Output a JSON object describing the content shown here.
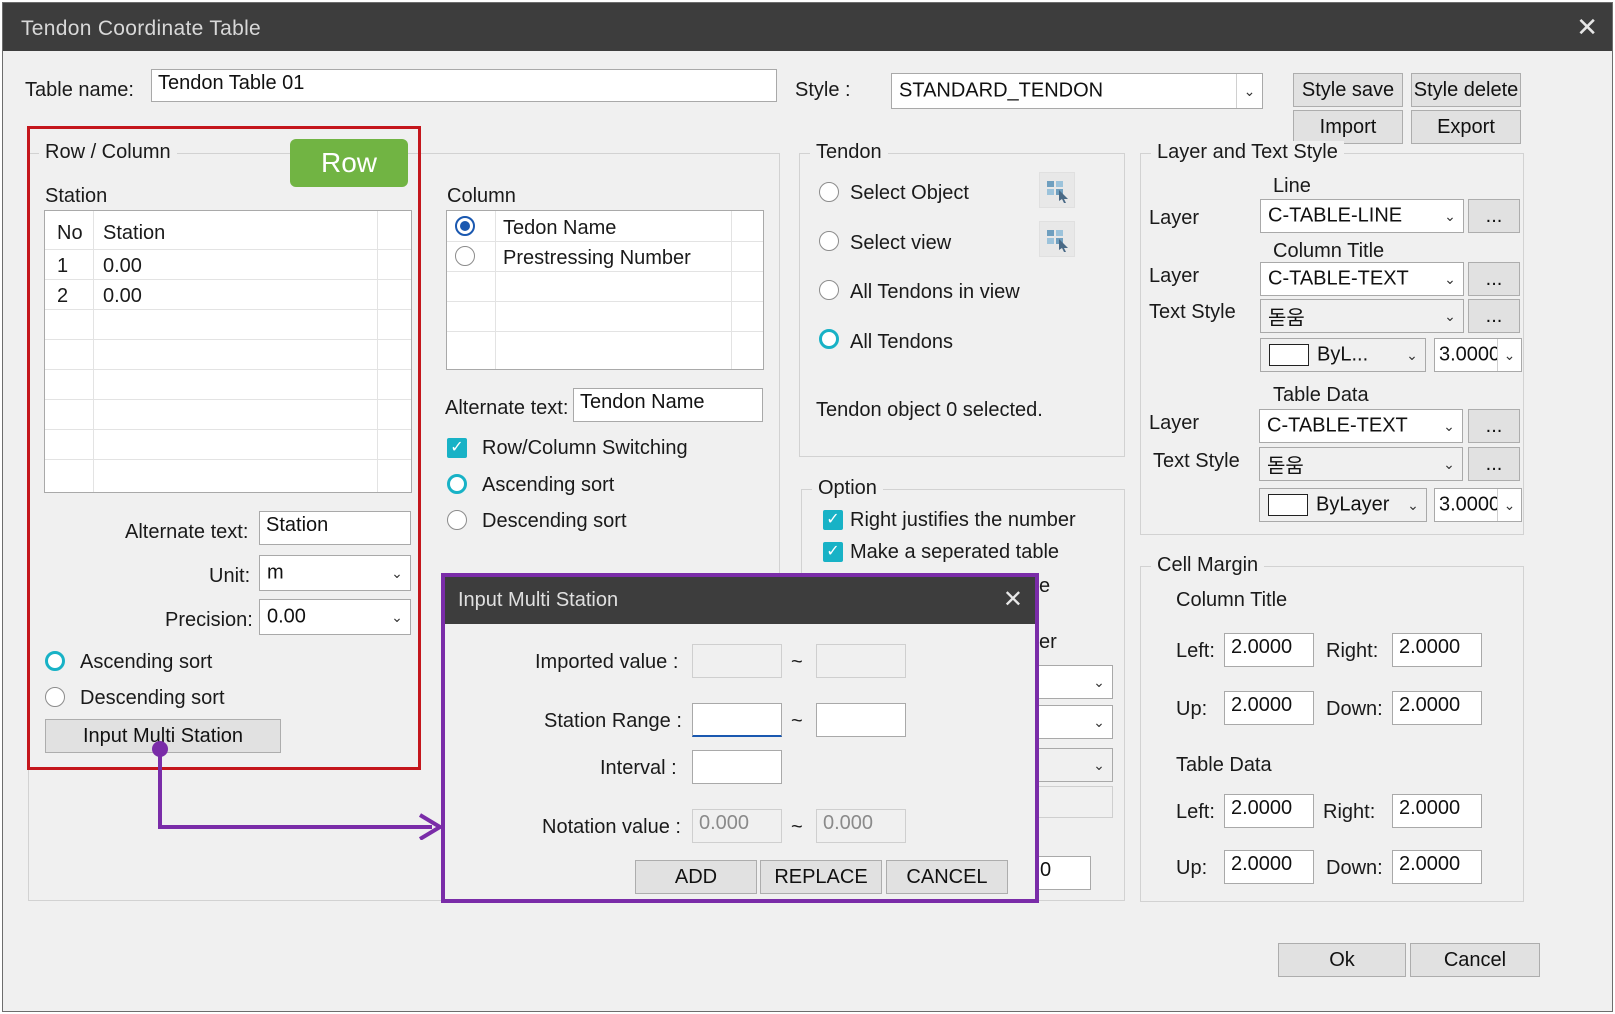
{
  "window": {
    "title": "Tendon Coordinate Table",
    "close_glyph": "✕"
  },
  "top": {
    "table_name_label": "Table name:",
    "table_name_value": "Tendon Table 01",
    "style_label": "Style :",
    "style_value": "STANDARD_TENDON",
    "style_save": "Style save",
    "style_delete": "Style delete",
    "import": "Import",
    "export": "Export"
  },
  "row_column": {
    "group_title": "Row / Column",
    "badge": "Row",
    "station_label": "Station",
    "station_table": {
      "headers": [
        "No",
        "Station"
      ],
      "rows": [
        [
          "1",
          "0.00"
        ],
        [
          "2",
          "0.00"
        ]
      ]
    },
    "alt_text_label": "Alternate text:",
    "alt_text_value": "Station",
    "unit_label": "Unit:",
    "unit_value": "m",
    "precision_label": "Precision:",
    "precision_value": "0.00",
    "ascending": "Ascending sort",
    "descending": "Descending sort",
    "input_multi_station": "Input Multi Station"
  },
  "column": {
    "label": "Column",
    "items": [
      "Tedon Name",
      "Prestressing Number"
    ],
    "alt_text_label": "Alternate text:",
    "alt_text_value": "Tendon Name",
    "switching": "Row/Column Switching",
    "ascending": "Ascending sort",
    "descending": "Descending sort"
  },
  "tendon": {
    "group_title": "Tendon",
    "options": [
      "Select Object",
      "Select view",
      "All Tendons in view",
      "All Tendons"
    ],
    "status": "Tendon object 0 selected."
  },
  "option": {
    "group_title": "Option",
    "right_justify": "Right justifies the number",
    "separated": "Make a seperated table",
    "partial_e": "e",
    "partial_er": "er",
    "partial_zero": "0"
  },
  "layer_text": {
    "group_title": "Layer and Text Style",
    "line_title": "Line",
    "column_title": "Column Title",
    "table_data_title": "Table Data",
    "layer_label": "Layer",
    "text_style_label": "Text Style",
    "line_layer": "C-TABLE-LINE",
    "col_layer": "C-TABLE-TEXT",
    "col_text_style": "돋움",
    "col_color": "ByL...",
    "col_height": "3.0000",
    "data_layer": "C-TABLE-TEXT",
    "data_text_style": "돋움",
    "data_color": "ByLayer",
    "data_height": "3.0000",
    "dots": "..."
  },
  "cell_margin": {
    "group_title": "Cell Margin",
    "column_title": "Column Title",
    "table_data": "Table Data",
    "left_label": "Left:",
    "right_label": "Right:",
    "up_label": "Up:",
    "down_label": "Down:",
    "ct_left": "2.0000",
    "ct_right": "2.0000",
    "ct_up": "2.0000",
    "ct_down": "2.0000",
    "td_left": "2.0000",
    "td_right": "2.0000",
    "td_up": "2.0000",
    "td_down": "2.0000"
  },
  "footer": {
    "ok": "Ok",
    "cancel": "Cancel"
  },
  "multi_station": {
    "title": "Input Multi Station",
    "close_glyph": "✕",
    "imported_label": "Imported value :",
    "range_label": "Station Range :",
    "interval_label": "Interval :",
    "notation_label": "Notation value :",
    "tilde": "~",
    "notation_from": "0.000",
    "notation_to": "0.000",
    "add": "ADD",
    "replace": "REPLACE",
    "cancel": "CANCEL"
  },
  "colors": {
    "highlight_red": "#c4161c",
    "badge_green": "#71b443",
    "callout_purple": "#7a2ca8",
    "accent_teal": "#18b2c6"
  }
}
